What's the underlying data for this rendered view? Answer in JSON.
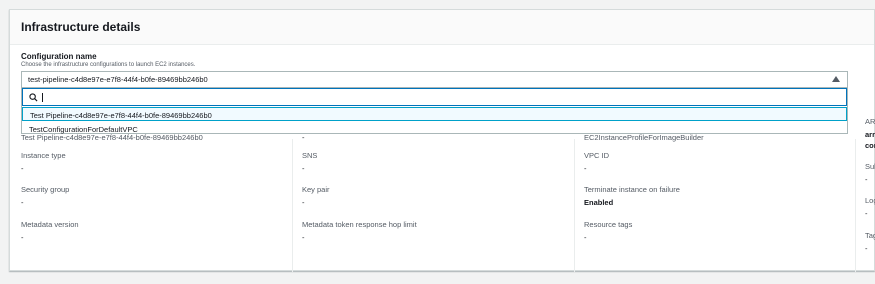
{
  "panel": {
    "title": "Infrastructure details"
  },
  "config": {
    "label": "Configuration name",
    "description": "Choose the infrastructure configurations to launch EC2 instances.",
    "selected": "test-pipeline-c4d8e97e-e7f8-44f4-b0fe-89469bb246b0",
    "search_value": "",
    "options": [
      "Test Pipeline-c4d8e97e-e7f8-44f4-b0fe-89469bb246b0",
      "TestConfigurationForDefaultVPC"
    ]
  },
  "hidden_row": {
    "col1": "Test Pipeline-c4d8e97e-e7f8-44f4-b0fe-89469bb246b0",
    "col2": "-",
    "col3": "EC2InstanceProfileForImageBuilder"
  },
  "details": {
    "instance_type": {
      "label": "Instance type",
      "value": "-"
    },
    "sns": {
      "label": "SNS",
      "value": "-"
    },
    "vpc_id": {
      "label": "VPC ID",
      "value": "-"
    },
    "security_group": {
      "label": "Security group",
      "value": "-"
    },
    "key_pair": {
      "label": "Key pair",
      "value": "-"
    },
    "terminate": {
      "label": "Terminate instance on failure",
      "value": "Enabled"
    },
    "metadata_version": {
      "label": "Metadata version",
      "value": "-"
    },
    "hop_limit": {
      "label": "Metadata token response hop limit",
      "value": "-"
    },
    "resource_tags": {
      "label": "Resource tags",
      "value": "-"
    }
  },
  "right_column_partial": {
    "ar": "AR",
    "arn": "arr",
    "con": "cor",
    "sub": "Sul",
    "sub_val": "-",
    "log": "Log",
    "log_val": "-",
    "tag": "Tag",
    "tag_val": "-"
  }
}
